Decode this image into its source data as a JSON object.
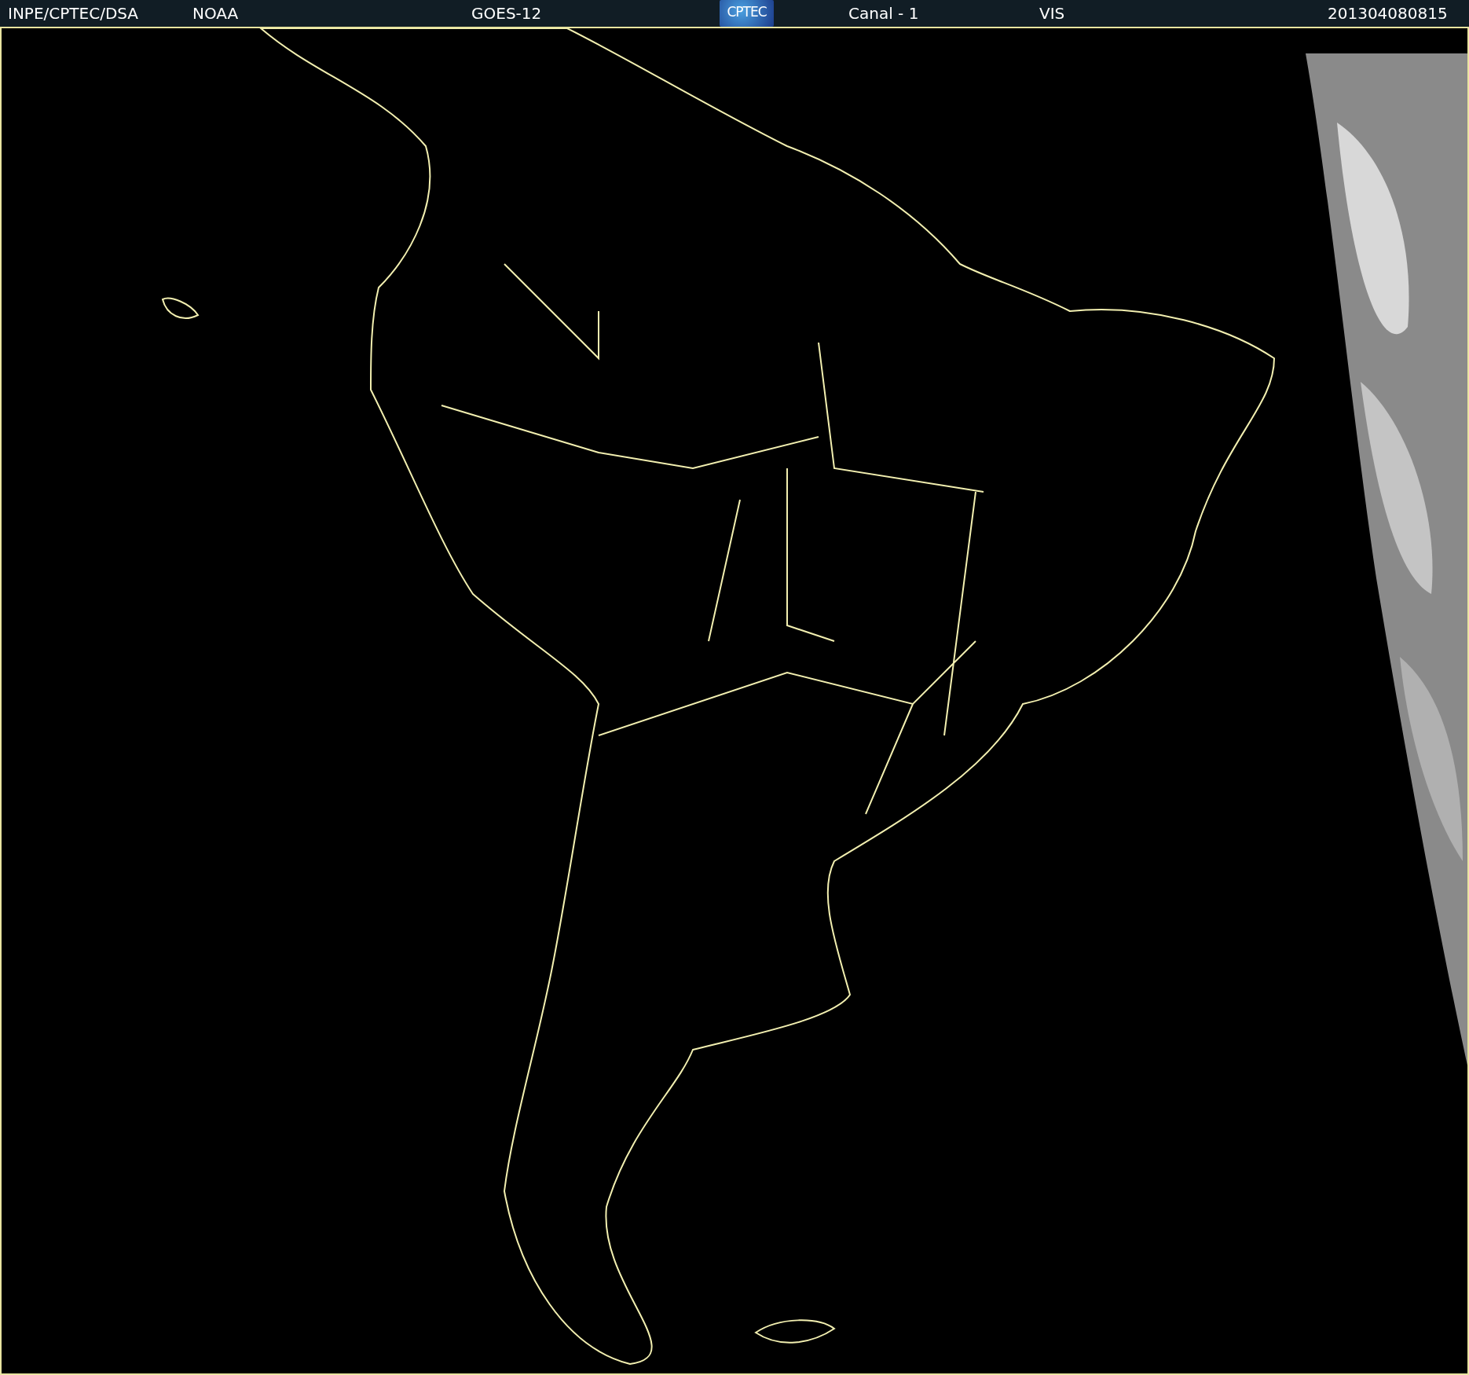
{
  "header": {
    "items": [
      {
        "kind": "text",
        "text": "INPE/CPTEC/DSA"
      },
      {
        "kind": "text",
        "text": "NOAA"
      },
      {
        "kind": "text",
        "text": "GOES-12"
      },
      {
        "kind": "logo",
        "text": "CPTEC"
      },
      {
        "kind": "text",
        "text": "Canal - 1"
      },
      {
        "kind": "text",
        "text": "VIS"
      },
      {
        "kind": "text",
        "text": "201304080815"
      }
    ]
  }
}
